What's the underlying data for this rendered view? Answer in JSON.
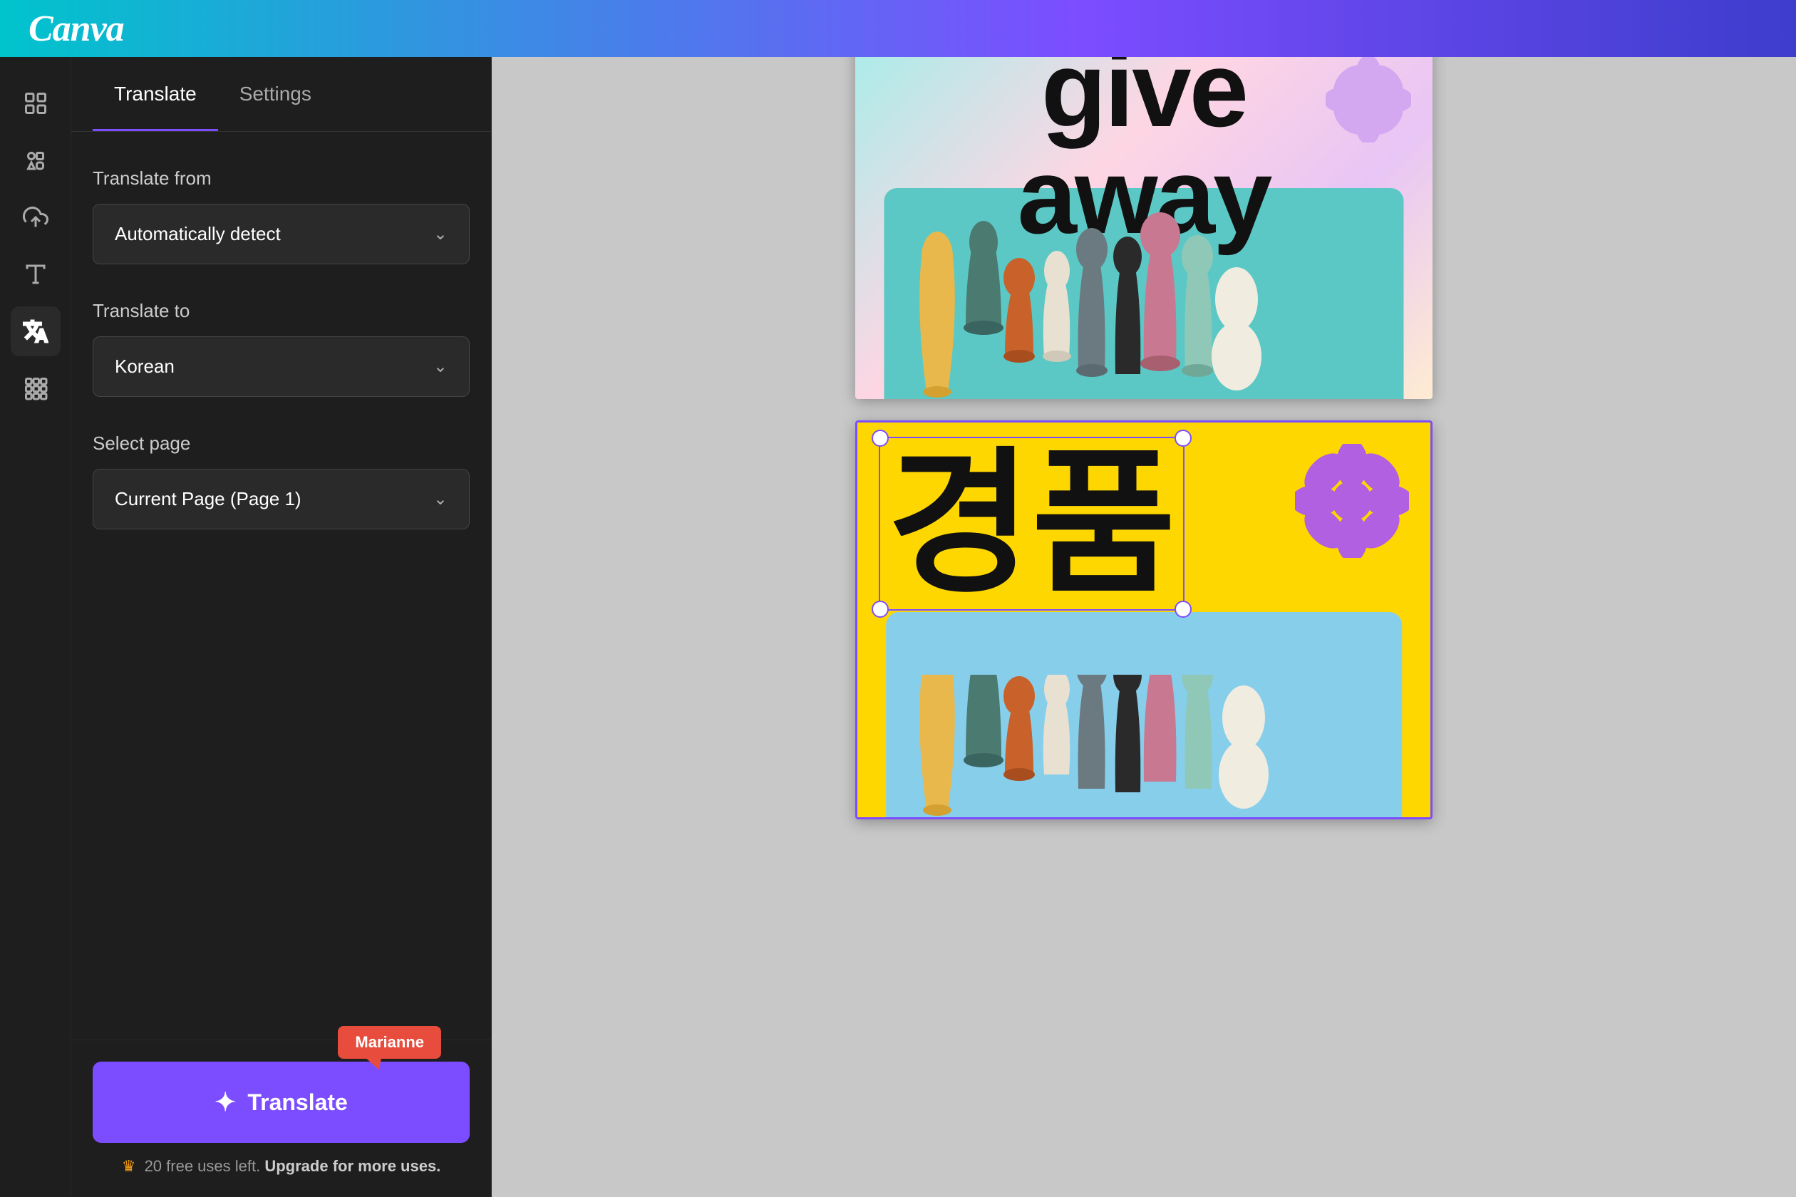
{
  "header": {
    "logo": "Canva",
    "background_gradient": "linear-gradient(90deg, #00c4cc 0%, #7c4dff 60%, #3d3dcc 100%)"
  },
  "sidebar": {
    "icons": [
      {
        "name": "grid-layout-icon",
        "label": "Grid Layout",
        "active": false
      },
      {
        "name": "elements-icon",
        "label": "Elements",
        "active": false
      },
      {
        "name": "upload-icon",
        "label": "Upload",
        "active": false
      },
      {
        "name": "text-icon",
        "label": "Text",
        "active": false
      },
      {
        "name": "translate-icon",
        "label": "Translate",
        "active": true
      },
      {
        "name": "apps-icon",
        "label": "Apps",
        "active": false
      }
    ]
  },
  "translate_panel": {
    "tabs": [
      {
        "id": "translate",
        "label": "Translate",
        "active": true
      },
      {
        "id": "settings",
        "label": "Settings",
        "active": false
      }
    ],
    "translate_from_label": "Translate from",
    "translate_from_value": "Automatically detect",
    "translate_to_label": "Translate to",
    "translate_to_value": "Korean",
    "select_page_label": "Select page",
    "select_page_value": "Current Page (Page 1)",
    "user_badge": "Marianne",
    "translate_button_label": "Translate",
    "usage_text": "20 free uses left.",
    "upgrade_text": "Upgrade for more uses."
  },
  "canvas": {
    "card1": {
      "text_line1": "give",
      "text_line2": "away",
      "background": "giveaway"
    },
    "card2": {
      "korean_text": "경품",
      "background": "yellow",
      "selected": true
    }
  }
}
